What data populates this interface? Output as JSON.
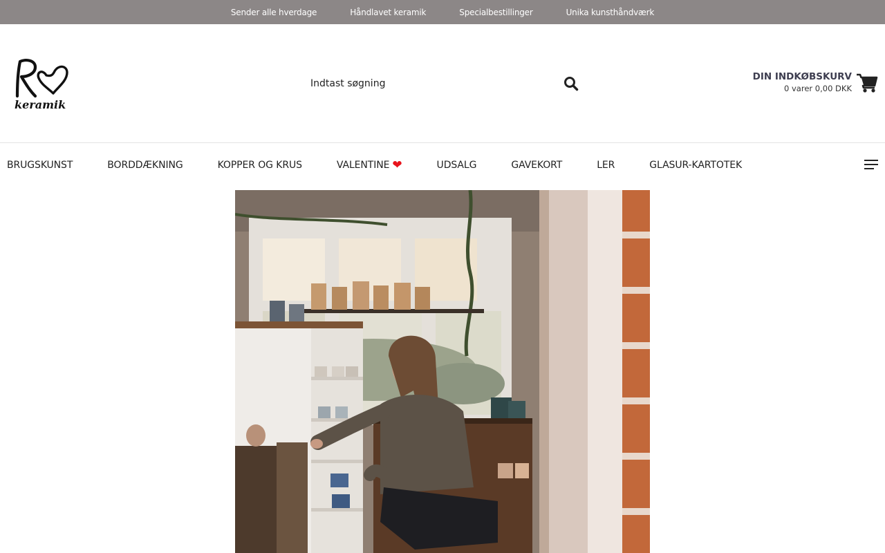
{
  "topbar": {
    "items": [
      "Sender alle hverdage",
      "Håndlavet keramik",
      "Specialbestillinger",
      "Unika kunsthåndværk"
    ]
  },
  "header": {
    "logo_text": "R keramik",
    "search": {
      "placeholder": "Indtast søgning",
      "icon": "search-icon"
    },
    "cart": {
      "title": "DIN INDKØBSKURV",
      "summary": "0 varer 0,00 DKK",
      "icon": "shopping-cart-icon"
    }
  },
  "nav": {
    "items": [
      "BRUGSKUNST",
      "BORDDÆKNING",
      "KOPPER OG KRUS",
      "VALENTINE",
      "UDSALG",
      "GAVEKORT",
      "LER",
      "GLASUR-KARTOTEK"
    ],
    "valentine_emoji": "❤",
    "menu_icon": "hamburger-menu-icon"
  },
  "hero": {
    "description_icon": "photo-woman-arranging-ceramics"
  },
  "colors": {
    "topbar_bg": "#8c8787",
    "cart_title": "#3e3e50",
    "heart": "#e8141c"
  }
}
